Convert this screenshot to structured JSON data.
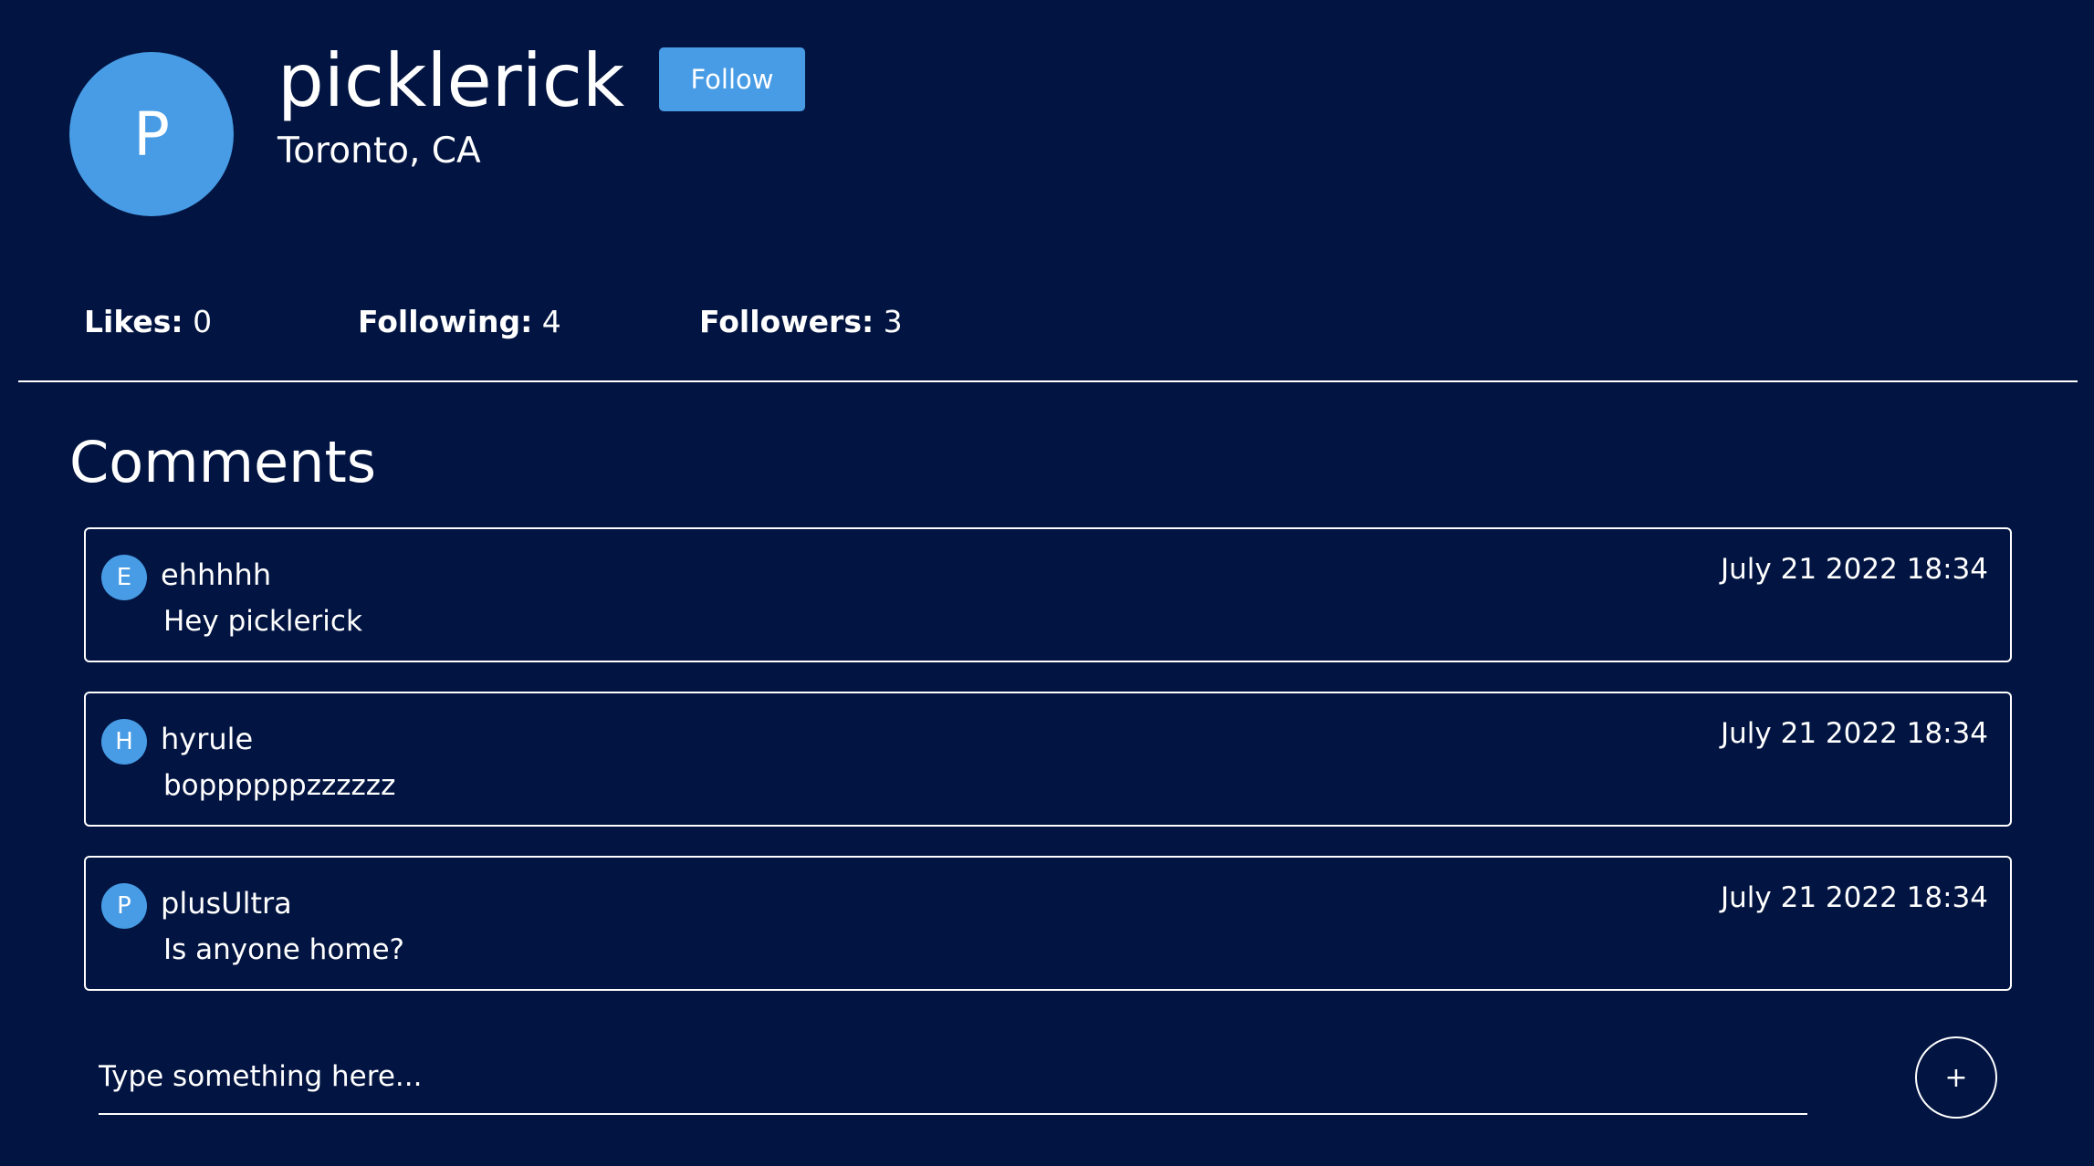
{
  "profile": {
    "avatar_initial": "P",
    "username": "picklerick",
    "location": "Toronto, CA",
    "follow_label": "Follow"
  },
  "stats": {
    "likes_label": "Likes:",
    "likes_value": "0",
    "following_label": "Following:",
    "following_value": "4",
    "followers_label": "Followers:",
    "followers_value": "3"
  },
  "comments": {
    "title": "Comments",
    "items": [
      {
        "initial": "E",
        "author": "ehhhhh",
        "text": "Hey picklerick",
        "time": "July 21 2022 18:34"
      },
      {
        "initial": "H",
        "author": "hyrule",
        "text": "boppppppzzzzzz",
        "time": "July 21 2022 18:34"
      },
      {
        "initial": "P",
        "author": "plusUltra",
        "text": "Is anyone home?",
        "time": "July 21 2022 18:34"
      }
    ],
    "input_placeholder": "Type something here...",
    "add_label": "+"
  },
  "colors": {
    "background": "#021441",
    "accent": "#479ce5",
    "text": "#ffffff"
  }
}
